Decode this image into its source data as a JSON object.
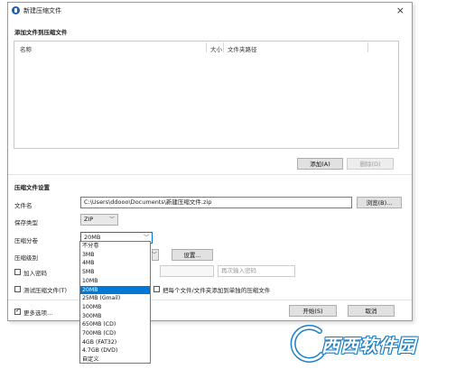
{
  "window": {
    "title": "新建压缩文件",
    "close_glyph": "×"
  },
  "add_files": {
    "section_title": "添加文件到压缩文件",
    "columns": {
      "name": "名称",
      "size": "大小",
      "folder": "文件夹路径"
    },
    "add_button": "添加(A)",
    "delete_button": "删除(D)"
  },
  "settings": {
    "section_title": "压缩文件设置",
    "filename_label": "文件名",
    "filename_value": "C:\\Users\\ddooo\\Documents\\新建压缩文件.zip",
    "browse_button": "浏览(B)...",
    "save_type_label": "保存类型",
    "save_type_value": "ZIP",
    "split_label": "压缩分卷",
    "split_value": "20MB",
    "level_label": "压缩级别",
    "settings_button": "设置...",
    "password_label": "加入密码",
    "reenter_password_placeholder": "再次输入密码",
    "test_label": "测试压缩文件(T)",
    "each_file_label": "把每个文件/文件夹添加到单独的压缩文件",
    "more_options_label": "更多选项...",
    "start_button": "开始(S)",
    "cancel_button": "取消"
  },
  "split_options": [
    "不分卷",
    "3MB",
    "4MB",
    "5MB",
    "10MB",
    "20MB",
    "25MB (Gmail)",
    "100MB",
    "300MB",
    "650MB (CD)",
    "700MB (CD)",
    "4GB (FAT32)",
    "4.7GB (DVD)",
    "自定义"
  ],
  "split_selected_index": 5,
  "checkbox_states": {
    "password": false,
    "test": false,
    "each_file": false,
    "more_options": true
  },
  "watermark": {
    "text": "西西软件园"
  },
  "colors": {
    "accent": "#0078d7",
    "brand_icon": "#1e5fb4",
    "watermark": "#1d7fc4"
  }
}
